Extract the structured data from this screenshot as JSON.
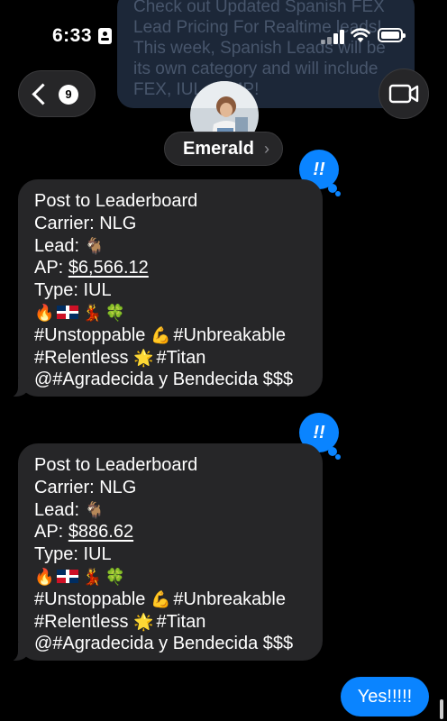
{
  "status_bar": {
    "time": "6:33"
  },
  "notification_banner": {
    "text": "Check out Updated Spanish FEX Lead Pricing For Realtime leads! This week, Spanish Leads will be its own category and will include FEX, IUL, & MP!"
  },
  "header": {
    "back_badge_count": "9",
    "contact_name": "Emerald",
    "chevron": "›"
  },
  "reaction": {
    "symbol": "!!"
  },
  "messages": [
    {
      "lines": {
        "l1": "Post to Leaderboard",
        "l2": "Carrier: NLG",
        "l3_label": "Lead:",
        "l3_emoji": "🐐",
        "l4_label": "AP:",
        "l4_value": "$6,566.12",
        "l5": "Type: IUL",
        "l6_e1": "🔥",
        "l6_e2": "💃",
        "l6_e3": "🍀",
        "l7_a": "#Unstoppable",
        "l7_emoji": "💪",
        "l7_b": "#Unbreakable",
        "l8_a": "#Relentless",
        "l8_emoji": "🌟",
        "l8_b": "#Titan",
        "l9": "@#Agradecida y Bendecida $$$"
      }
    },
    {
      "lines": {
        "l1": "Post to Leaderboard",
        "l2": "Carrier: NLG",
        "l3_label": "Lead:",
        "l3_emoji": "🐐",
        "l4_label": "AP:",
        "l4_value": "$886.62",
        "l5": "Type: IUL",
        "l6_e1": "🔥",
        "l6_e2": "💃",
        "l6_e3": "🍀",
        "l7_a": "#Unstoppable",
        "l7_emoji": "💪",
        "l7_b": "#Unbreakable",
        "l8_a": "#Relentless",
        "l8_emoji": "🌟",
        "l8_b": "#Titan",
        "l9": "@#Agradecida y Bendecida $$$"
      }
    }
  ],
  "sent_message": {
    "text": "Yes!!!!!"
  },
  "colors": {
    "background": "#000000",
    "incoming_bubble": "#262628",
    "outgoing_bubble": "#0a84ff",
    "banner": "#1e2a3c"
  },
  "icons": {
    "back": "chevron-left-icon",
    "video": "video-camera-icon",
    "signal": "cellular-signal-icon",
    "wifi": "wifi-icon",
    "battery": "battery-icon",
    "flag": "dominican-flag-icon"
  }
}
